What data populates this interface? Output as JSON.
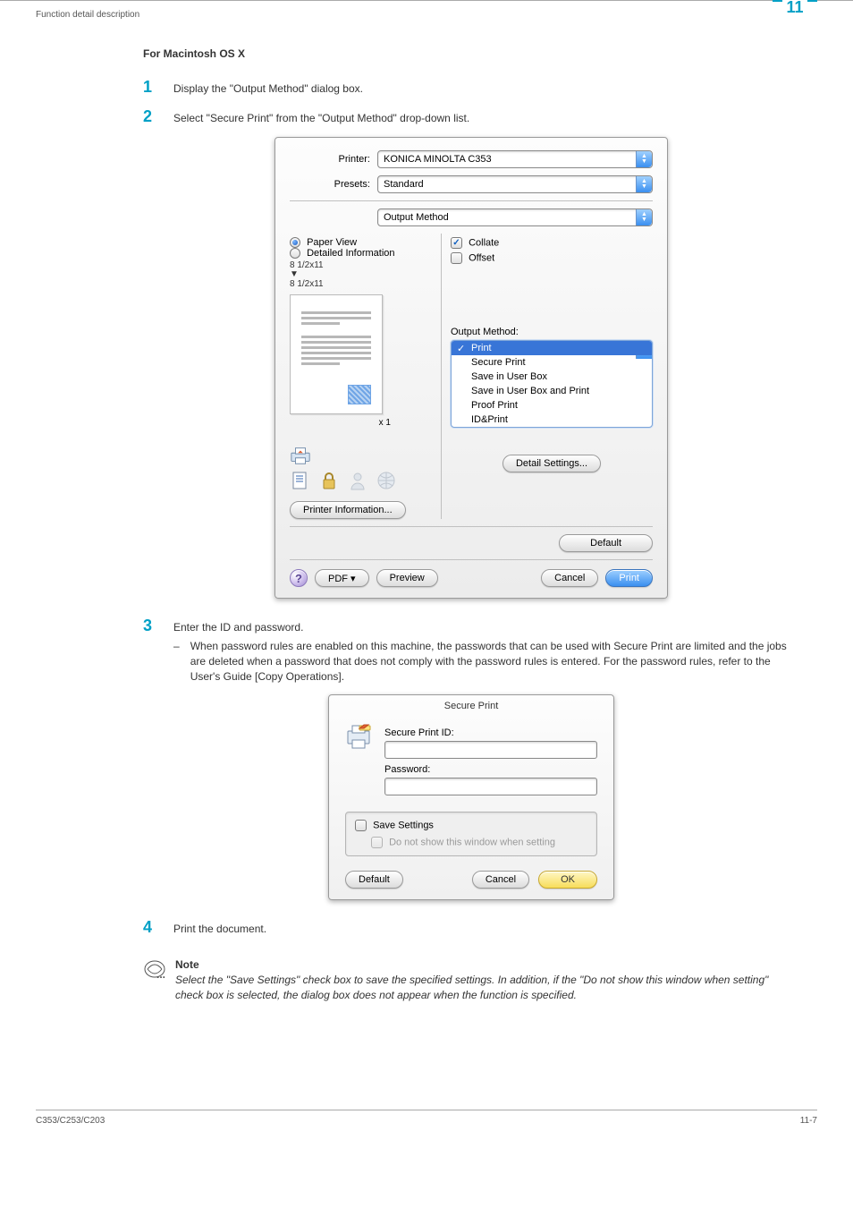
{
  "header": {
    "section": "Function detail description",
    "chapter_number": "11"
  },
  "section_title": "For Macintosh OS X",
  "steps": {
    "s1": {
      "num": "1",
      "text": "Display the \"Output Method\" dialog box."
    },
    "s2": {
      "num": "2",
      "text": "Select \"Secure Print\" from the \"Output Method\" drop-down list."
    },
    "s3": {
      "num": "3",
      "text": "Enter the ID and password.",
      "bullet": "When password rules are enabled on this machine, the passwords that can be used with Secure Print are limited and the jobs are deleted when a password that does not comply with the password rules is entered. For the password rules, refer to the User's Guide [Copy Operations]."
    },
    "s4": {
      "num": "4",
      "text": "Print the document."
    }
  },
  "dlg1": {
    "printer_label": "Printer:",
    "printer_value": "KONICA MINOLTA C353",
    "presets_label": "Presets:",
    "presets_value": "Standard",
    "tab_value": "Output Method",
    "paper_view": "Paper View",
    "detailed_info": "Detailed Information",
    "size1": "8 1/2x11",
    "size2": "8 1/2x11",
    "copies": "x 1",
    "printer_info_btn": "Printer Information...",
    "collate": "Collate",
    "offset": "Offset",
    "output_method_label": "Output Method:",
    "popup": {
      "print": "Print",
      "secure": "Secure Print",
      "save_box": "Save in User Box",
      "save_box_print": "Save in User Box and Print",
      "proof": "Proof Print",
      "idprint": "ID&Print"
    },
    "detail_settings": "Detail Settings...",
    "default_btn": "Default",
    "pdf_btn": "PDF ▾",
    "preview_btn": "Preview",
    "cancel_btn": "Cancel",
    "print_btn": "Print"
  },
  "dlg2": {
    "title": "Secure Print",
    "id_label": "Secure Print ID:",
    "pw_label": "Password:",
    "save_settings": "Save Settings",
    "do_not_show": "Do not show this window when setting",
    "default_btn": "Default",
    "cancel_btn": "Cancel",
    "ok_btn": "OK"
  },
  "note": {
    "title": "Note",
    "text": "Select the \"Save Settings\" check box to save the specified settings. In addition, if the \"Do not show this window when setting\" check box is selected, the dialog box does not appear when the function is specified."
  },
  "footer": {
    "left": "C353/C253/C203",
    "right": "11-7"
  }
}
